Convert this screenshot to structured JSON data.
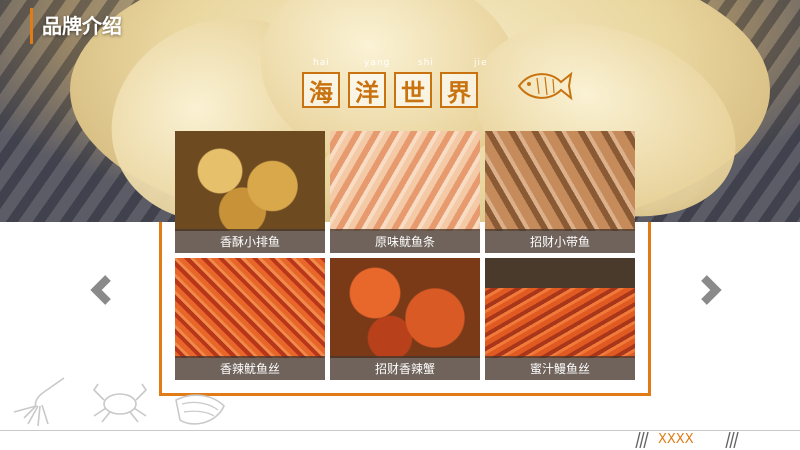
{
  "page": {
    "title": "品牌介绍"
  },
  "header": {
    "chars": [
      "海",
      "洋",
      "世",
      "界"
    ],
    "pinyin": [
      "hai",
      "yang",
      "shi",
      "jie"
    ]
  },
  "products": [
    {
      "name": "香酥小排鱼",
      "color": "#b8862f"
    },
    {
      "name": "原味鱿鱼条",
      "color": "#e9a57a"
    },
    {
      "name": "招财小带鱼",
      "color": "#a86f43"
    },
    {
      "name": "香辣鱿鱼丝",
      "color": "#d9521e"
    },
    {
      "name": "招财香辣蟹",
      "color": "#c9501c"
    },
    {
      "name": "蜜汁鳗鱼丝",
      "color": "#c8461d"
    }
  ],
  "navigation": {
    "prev_icon": "chevron-left-icon",
    "next_icon": "chevron-right-icon"
  },
  "footer": {
    "text": "XXXX"
  },
  "colors": {
    "accent": "#e07b16"
  }
}
